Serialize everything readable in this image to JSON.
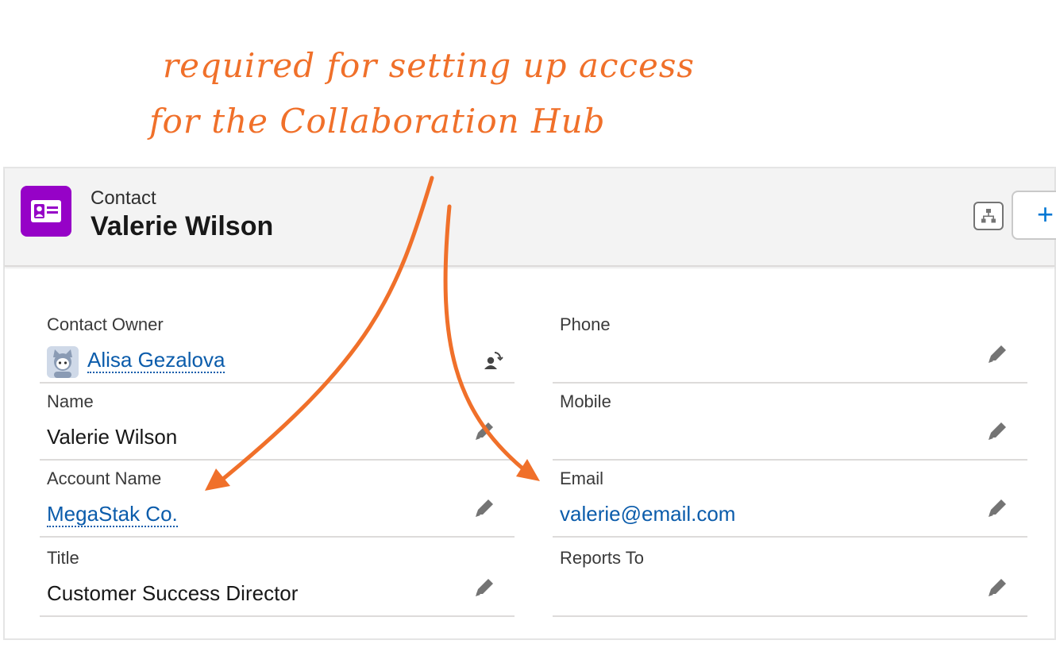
{
  "annotation": {
    "line1": "required for setting up access",
    "line2": "for the Collaboration Hub"
  },
  "header": {
    "object_type": "Contact",
    "record_name": "Valerie Wilson",
    "follow_symbol": "+"
  },
  "fields": {
    "contact_owner": {
      "label": "Contact Owner",
      "value": "Alisa Gezalova"
    },
    "phone": {
      "label": "Phone",
      "value": ""
    },
    "name": {
      "label": "Name",
      "value": "Valerie Wilson"
    },
    "mobile": {
      "label": "Mobile",
      "value": ""
    },
    "account_name": {
      "label": "Account Name",
      "value": "MegaStak Co."
    },
    "email": {
      "label": "Email",
      "value": "valerie@email.com"
    },
    "title": {
      "label": "Title",
      "value": "Customer Success Director"
    },
    "reports_to": {
      "label": "Reports To",
      "value": ""
    }
  },
  "colors": {
    "annotation": "#f0702a",
    "contact_icon": "#9602c7",
    "link": "#0b5cab"
  }
}
